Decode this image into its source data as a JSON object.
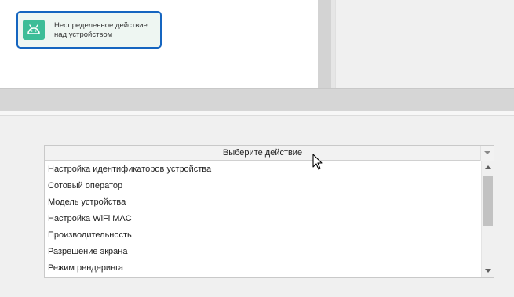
{
  "canvas": {
    "node": {
      "icon": "android-icon",
      "label_line1": "Неопределенное действие",
      "label_line2": "над устройством",
      "border_color": "#1565c0",
      "icon_color": "#3dbd98"
    }
  },
  "action_select": {
    "title": "Выберите действие",
    "items": [
      "Настройка идентификаторов устройства",
      "Сотовый оператор",
      "Модель устройства",
      "Настройка WiFi MAC",
      "Производительность",
      "Разрешение экрана",
      "Режим рендеринга"
    ]
  },
  "icons": {
    "dropdown": "chevron-down-icon",
    "scroll_up": "scroll-up-arrow-icon",
    "scroll_down": "scroll-down-arrow-icon",
    "cursor": "mouse-pointer-icon"
  }
}
